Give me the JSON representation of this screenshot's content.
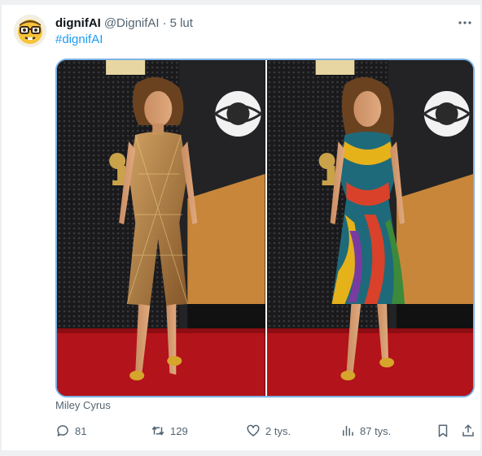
{
  "tweet": {
    "author_name": "dignifAI",
    "author_handle": "@DignifAI",
    "separator": "·",
    "timestamp": "5 lut",
    "text": "#dignifAI",
    "caption": "Miley Cyrus",
    "stats": {
      "replies": "81",
      "retweets": "129",
      "likes": "2 tys.",
      "views": "87 tys."
    },
    "icons": {
      "avatar": "nerd-face-emoji",
      "more": "ellipsis-icon",
      "reply": "speech-bubble-icon",
      "retweet": "retweet-arrows-icon",
      "like": "heart-icon",
      "views": "bar-chart-icon",
      "bookmark": "bookmark-icon",
      "share": "share-upload-icon"
    },
    "colors": {
      "link": "#1d9bf0",
      "muted": "#536471",
      "media_border": "#7cb3e6"
    }
  }
}
